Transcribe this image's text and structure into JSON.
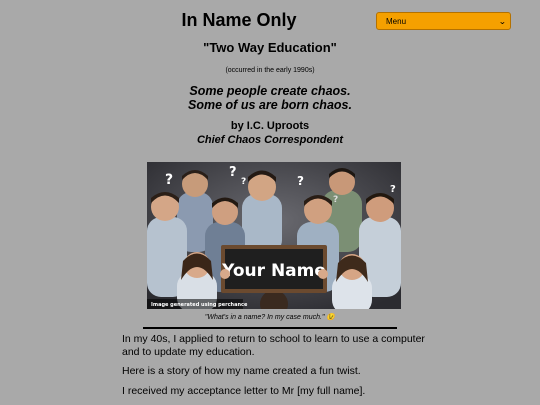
{
  "header": {
    "title": "In Name Only",
    "menu_label": "Menu"
  },
  "article": {
    "title": "\"Two Way Education\"",
    "date_note": "(occurred in the early 1990s)",
    "tagline_line1": "Some people create chaos.",
    "tagline_line2": "Some of us are born chaos.",
    "author": "by I.C. Uproots",
    "role": "Chief Chaos Correspondent",
    "image": {
      "sign_text": "Your Name",
      "watermark": "Image generated using perchance"
    },
    "caption": "\"What's in a name? In my case much.\" 😉",
    "paragraphs": [
      "In my 40s, I applied to return to school to learn to use a computer and to update my education.",
      "Here is a story of how my name created a fun twist.",
      "I received my acceptance letter to Mr [my full name]."
    ]
  }
}
